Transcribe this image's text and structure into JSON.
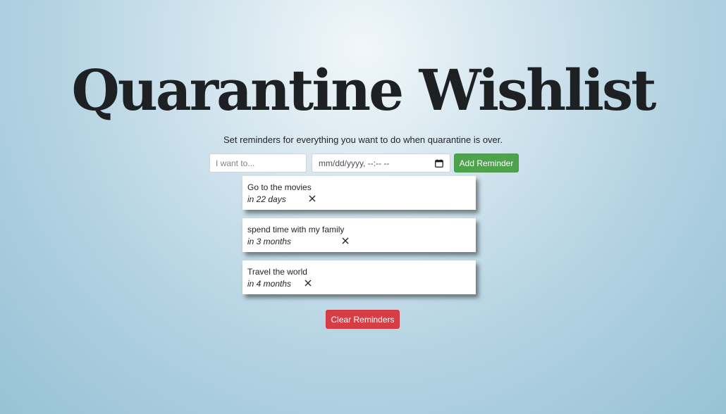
{
  "header": {
    "title": "Quarantine Wishlist",
    "subtitle": "Set reminders for everything you want to do when quarantine is over."
  },
  "form": {
    "text_placeholder": "I want to...",
    "date_placeholder": "mm/dd/yyyy, --:-- --",
    "date_icon": "calendar-icon",
    "add_label": "Add Reminder"
  },
  "reminders": [
    {
      "text": "Go to the movies",
      "time": "in 22 days"
    },
    {
      "text": "spend time with my family",
      "time": "in 3 months"
    },
    {
      "text": "Travel the world",
      "time": "in 4 months"
    }
  ],
  "clear_label": "Clear Reminders",
  "colors": {
    "add_button": "#4ea24d",
    "clear_button": "#d63d45",
    "title": "#1e2124"
  }
}
